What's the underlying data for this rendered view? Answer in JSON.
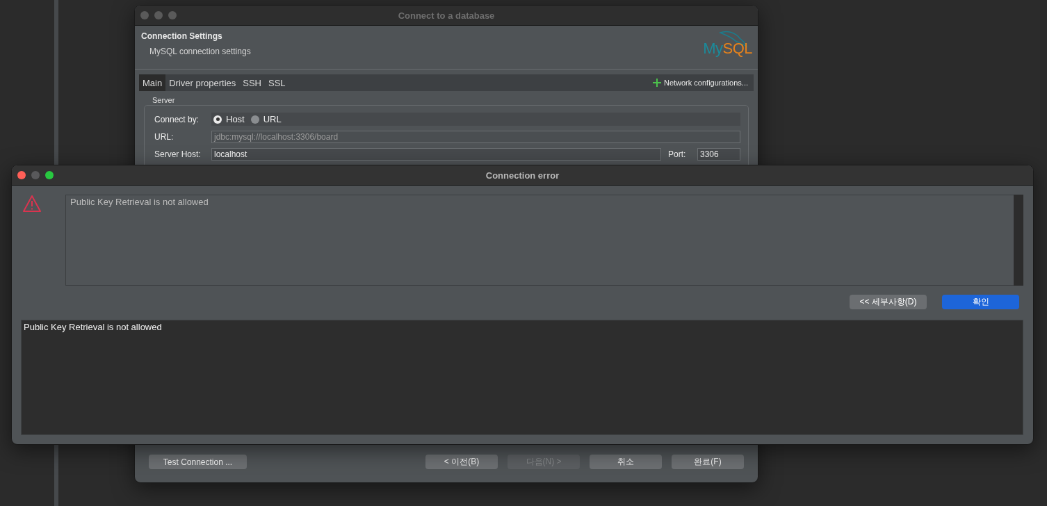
{
  "back_window": {
    "title": "Connect to a database",
    "focused": false,
    "header": {
      "title": "Connection Settings",
      "subtitle": "MySQL connection settings",
      "logo": {
        "part_1": "My",
        "part_2": "SQL"
      }
    },
    "tabs": [
      {
        "label": "Main",
        "selected": true
      },
      {
        "label": "Driver properties",
        "selected": false
      },
      {
        "label": "SSH",
        "selected": false
      },
      {
        "label": "SSL",
        "selected": false
      }
    ],
    "network_button": "Network configurations...",
    "server": {
      "group_label": "Server",
      "connect_by": {
        "label": "Connect by:",
        "options": [
          {
            "label": "Host",
            "selected": true
          },
          {
            "label": "URL",
            "selected": false
          }
        ]
      },
      "url": {
        "label": "URL:",
        "value": "jdbc:mysql://localhost:3306/board",
        "disabled": true
      },
      "host": {
        "label": "Server Host:",
        "value": "localhost"
      },
      "port": {
        "label": "Port:",
        "value": "3306"
      }
    },
    "test_button": "Test Connection ...",
    "buttons": [
      {
        "label": "< 이전(B)",
        "disabled": false
      },
      {
        "label": "다음(N) >",
        "disabled": true
      },
      {
        "label": "취소",
        "disabled": false
      },
      {
        "label": "완료(F)",
        "disabled": false
      }
    ]
  },
  "dialog": {
    "title": "Connection error",
    "focused": true,
    "message": "Public Key Retrieval is not allowed",
    "buttons": [
      {
        "label": "<< 세부사항(D)",
        "kind": "secondary"
      },
      {
        "label": "확인",
        "kind": "primary"
      }
    ],
    "details": "Public Key Retrieval is not allowed"
  }
}
